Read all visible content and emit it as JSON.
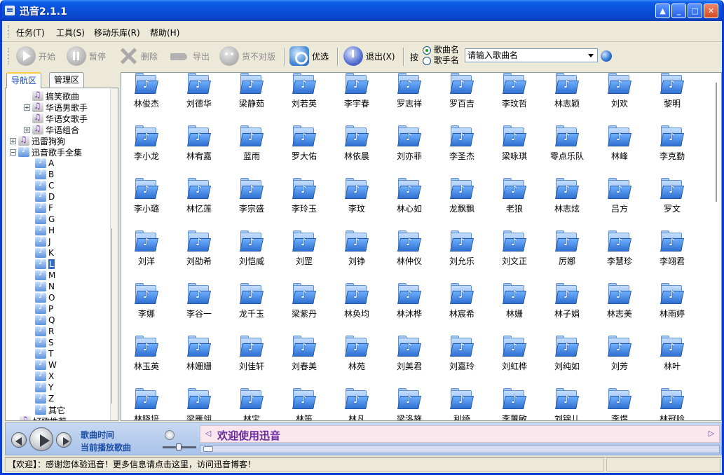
{
  "window": {
    "title": "迅音2.1.1"
  },
  "menu": [
    "任务(T)",
    "工具(S)",
    "移动乐库(R)",
    "帮助(H)"
  ],
  "toolbar": {
    "start": "开始",
    "pause": "暂停",
    "delete": "删除",
    "export": "导出",
    "mismatch": "货不对版",
    "optimize": "优选",
    "exit": "退出(X)",
    "by": "按",
    "radio_song": "歌曲名",
    "radio_singer": "歌手名",
    "search_value": "请输入歌曲名"
  },
  "tabs": {
    "nav": "导航区",
    "manage": "管理区"
  },
  "tree": {
    "top_items": [
      {
        "label": "搞笑歌曲",
        "expander": ""
      },
      {
        "label": "华语男歌手",
        "expander": "+"
      },
      {
        "label": "华语女歌手",
        "expander": ""
      },
      {
        "label": "华语组合",
        "expander": "+"
      }
    ],
    "xunlei": "迅雷狗狗",
    "collection": "迅音歌手全集",
    "letters": [
      "A",
      "B",
      "C",
      "D",
      "F",
      "G",
      "H",
      "J",
      "K",
      "L",
      "M",
      "N",
      "O",
      "P",
      "Q",
      "R",
      "S",
      "T",
      "W",
      "X",
      "Y",
      "Z",
      "其它"
    ],
    "selected_letter": "L",
    "partial": "好歌推荐"
  },
  "artists": [
    "林俊杰",
    "刘德华",
    "梁静茹",
    "刘若英",
    "李宇春",
    "罗志祥",
    "罗百吉",
    "李玟哲",
    "林志颖",
    "刘欢",
    "黎明",
    "李小龙",
    "林宥嘉",
    "蓝雨",
    "罗大佑",
    "林依晨",
    "刘亦菲",
    "李圣杰",
    "梁咏琪",
    "零点乐队",
    "林峰",
    "李克勤",
    "李小璐",
    "林忆莲",
    "李宗盛",
    "李玲玉",
    "李玟",
    "林心如",
    "龙飘飘",
    "老狼",
    "林志炫",
    "吕方",
    "罗文",
    "刘洋",
    "刘劭希",
    "刘恺威",
    "刘罡",
    "刘铮",
    "林仲仪",
    "刘允乐",
    "刘文正",
    "厉娜",
    "李慧珍",
    "李翊君",
    "李娜",
    "李谷一",
    "龙千玉",
    "梁紫丹",
    "林奂均",
    "林沐桦",
    "林宸希",
    "林姗",
    "林子娟",
    "林志美",
    "林雨婷",
    "林玉英",
    "林姗姗",
    "刘佳轩",
    "刘春美",
    "林苑",
    "刘美君",
    "刘嘉玲",
    "刘虹桦",
    "刘纯如",
    "刘芳",
    "林叶",
    "林晓培",
    "梁雁翎",
    "林宝",
    "林笛",
    "林凡",
    "梁洛施",
    "利绮",
    "李蕙敏",
    "刘锦儿",
    "李煜",
    "林冠吟"
  ],
  "player": {
    "song_time": "歌曲时间",
    "now_playing": "当前播放歌曲",
    "marquee": "欢迎使用迅音",
    "progress": 0
  },
  "status": "【欢迎】：感谢您体验迅音！更多信息请点击这里，访问迅音博客！"
}
